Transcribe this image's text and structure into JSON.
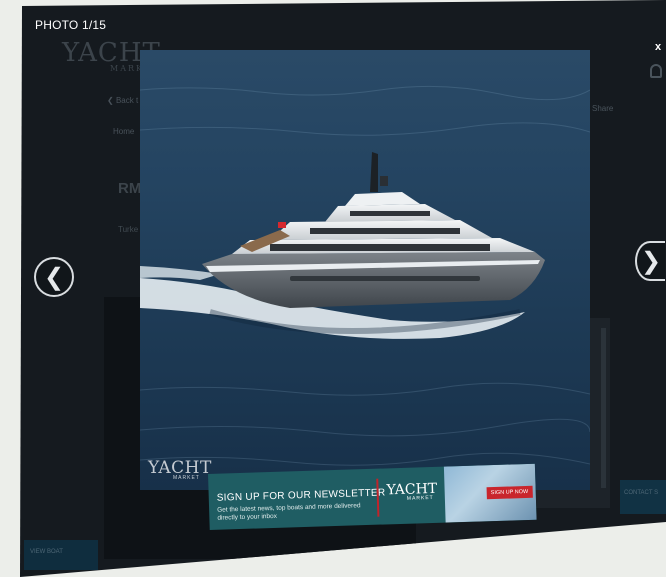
{
  "lightbox": {
    "counter": "PHOTO 1/15",
    "close_label": "x",
    "prev_label": "❮",
    "next_label": "❯"
  },
  "watermark": {
    "brand": "YACHT",
    "sub": "MARKET"
  },
  "background_page": {
    "logo": "YACHT",
    "logo_sub": "MARKET",
    "rm_text": "RM",
    "prefix_back": "Back t",
    "prefix_home": "Home",
    "prefix_turk": "Turke",
    "prefix_share": "Share",
    "view_boat": "VIEW BOAT",
    "contact": "CONTACT S"
  },
  "ad": {
    "title": "SIGN UP FOR OUR NEWSLETTER",
    "subtitle": "Get the latest news, top boats and more delivered directly to your inbox",
    "logo": "YACHT",
    "logo_sub": "MARKET",
    "button": "SIGN UP NOW"
  },
  "colors": {
    "ad_background": "#1f5d63",
    "ad_button": "#c9252c",
    "overlay": "#151a1f"
  }
}
